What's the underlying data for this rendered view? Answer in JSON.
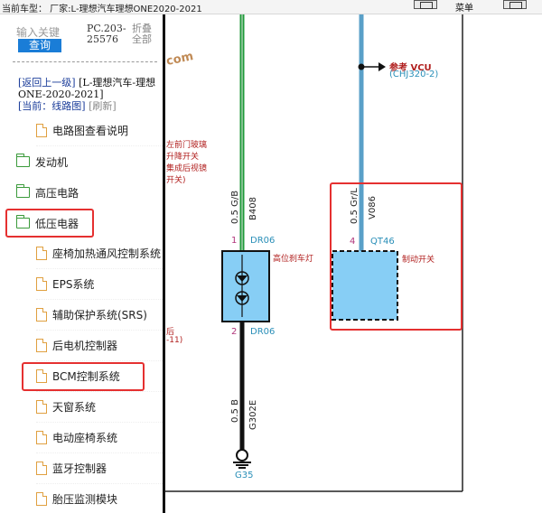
{
  "topbar": {
    "title": "当前车型：  厂家:L-理想汽车理想ONE2020-2021",
    "label": "菜单"
  },
  "search": {
    "placeholder": "输入关键",
    "button": "查询"
  },
  "pc_code": "PC.203-25576",
  "fold": "折叠全部",
  "watermark": "com",
  "breadcrumb": {
    "back": "[返回上一级]",
    "root": "[L-理想汽车-理想ONE-2020-2021]",
    "current": "[当前：线路图]",
    "refresh": "[刷新]"
  },
  "tree": [
    {
      "label": "电路图查看说明",
      "icon": "document-icon",
      "level": 1
    },
    {
      "label": "发动机",
      "icon": "folder-icon",
      "level": 0
    },
    {
      "label": "高压电路",
      "icon": "folder-icon",
      "level": 0
    },
    {
      "label": "低压电器",
      "icon": "folder-open-icon",
      "level": 0,
      "highlighted": true
    },
    {
      "label": "座椅加热通风控制系统",
      "icon": "document-icon",
      "level": 1
    },
    {
      "label": "EPS系统",
      "icon": "document-icon",
      "level": 1
    },
    {
      "label": "辅助保护系统(SRS)",
      "icon": "document-icon",
      "level": 1
    },
    {
      "label": "后电机控制器",
      "icon": "document-icon",
      "level": 1
    },
    {
      "label": "BCM控制系统",
      "icon": "document-icon",
      "level": 1,
      "highlighted": true
    },
    {
      "label": "天窗系统",
      "icon": "document-icon",
      "level": 1
    },
    {
      "label": "电动座椅系统",
      "icon": "document-icon",
      "level": 1
    },
    {
      "label": "蓝牙控制器",
      "icon": "document-icon",
      "level": 1
    },
    {
      "label": "胎压监测模块",
      "icon": "document-icon",
      "level": 1
    }
  ],
  "diagram": {
    "partial_label_1": "左前门玻璃",
    "partial_label_2": "升降开关",
    "partial_label_3": "集成后视镜",
    "partial_label_4": "开关)",
    "partial_label_5": "后",
    "partial_label_6": "-11)",
    "left_wire_top": "0.5 G/B",
    "left_wire_top_id": "B408",
    "left_pin_top": "1",
    "left_conn_top": "DR06",
    "lamp_label": "高位刹车灯",
    "left_pin_bottom": "2",
    "left_conn_bottom": "DR06",
    "left_wire_bottom": "0.5 B",
    "left_wire_bottom_id": "G302E",
    "ground": "G35",
    "ref_label": "参考 VCU",
    "ref_sub": "(CHJ320-2)",
    "right_wire": "0.5 Gr/L",
    "right_wire_id": "V086",
    "right_pin": "4",
    "right_conn": "QT46",
    "switch_label": "制动开关",
    "colors": {
      "green_wire": "#1f9a3a",
      "blue_wire": "#5aa0c8",
      "component_fill": "#87cef5",
      "highlight": "#e53030"
    }
  }
}
